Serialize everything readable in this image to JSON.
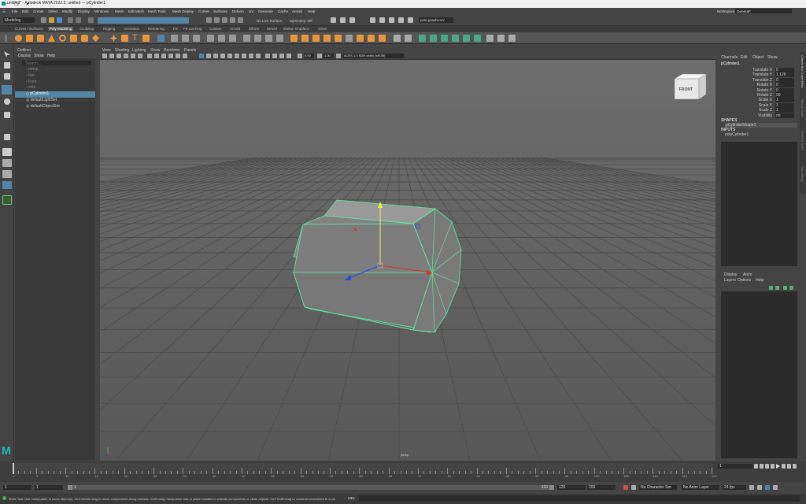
{
  "titlebar": {
    "title": "untitled* - Autodesk MAYA 2022.3: untitled   ---   pCylinder1",
    "minimize": "─",
    "maximize": "❐",
    "close": "✕"
  },
  "menubar": {
    "items": [
      "File",
      "Edit",
      "Create",
      "Select",
      "Modify",
      "Display",
      "Windows",
      "Mesh",
      "Edit Mesh",
      "Mesh Tools",
      "Mesh Display",
      "Curves",
      "Surfaces",
      "Deform",
      "UV",
      "Generate",
      "Cache",
      "Arnold",
      "Help"
    ],
    "workspace_label": "Workspace :",
    "workspace_value": "General*"
  },
  "statusline": {
    "mode": "Modeling",
    "live_surface": "No Live Surface",
    "symmetry": "Symmetry: Off",
    "login": "pete.graphicsrv"
  },
  "shelf_tabs": [
    "Curves / Surfaces",
    "Poly Modeling",
    "Sculpting",
    "Rigging",
    "Animation",
    "Rendering",
    "FX",
    "FX Caching",
    "Custom",
    "Arnold",
    "Bifrost",
    "MASH",
    "Motion Graphics",
    "XGen"
  ],
  "outliner": {
    "title": "Outliner",
    "menus": [
      "Display",
      "Show",
      "Help"
    ],
    "search_placeholder": "Search...",
    "items": [
      "persp",
      "top",
      "front",
      "side",
      "pCylinder1",
      "defaultLightSet",
      "defaultObjectSet"
    ],
    "selected_index": 4
  },
  "viewport": {
    "menus": [
      "View",
      "Shading",
      "Lighting",
      "Show",
      "Renderer",
      "Panels"
    ],
    "exposure": "0.00",
    "gamma": "1.00",
    "colorspace": "ACES 1.0 SDR-video (sRGB)",
    "camera_label": "persp",
    "viewcube_label": "FRONT"
  },
  "channelbox": {
    "menus": [
      "Channels",
      "Edit",
      "Object",
      "Show"
    ],
    "object": "pCylinder1",
    "attrs": [
      {
        "name": "Translate X",
        "value": "0"
      },
      {
        "name": "Translate Y",
        "value": "1.128"
      },
      {
        "name": "Translate Z",
        "value": "0"
      },
      {
        "name": "Rotate X",
        "value": "0"
      },
      {
        "name": "Rotate Y",
        "value": "0"
      },
      {
        "name": "Rotate Z",
        "value": "90"
      },
      {
        "name": "Scale X",
        "value": "1"
      },
      {
        "name": "Scale Y",
        "value": "1"
      },
      {
        "name": "Scale Z",
        "value": "1"
      },
      {
        "name": "Visibility",
        "value": "on"
      }
    ],
    "shapes_label": "SHAPES",
    "shape_name": "pCylinderShape1",
    "inputs_label": "INPUTS",
    "input_name": "polyCylinder1",
    "layer_tabs": [
      "Display",
      "Anim"
    ],
    "layer_menus": [
      "Layers",
      "Options",
      "Help"
    ],
    "side_tabs": [
      "Channel Box / Layer Editor",
      "Attribute Editor",
      "Modeling Toolkit",
      "Tool Settings"
    ]
  },
  "timeline": {
    "ticks": [
      "1",
      "5",
      "10",
      "15",
      "20",
      "25",
      "30",
      "35",
      "40",
      "45",
      "50",
      "55",
      "60",
      "65",
      "70",
      "75",
      "80",
      "85",
      "90",
      "95",
      "100",
      "105",
      "110",
      "115",
      "120"
    ],
    "current_frame": "1",
    "range_start": "1",
    "range_inner_start": "1",
    "range_inner_end": "120",
    "range_end": "120",
    "range_max": "200",
    "character_set": "No Character Set",
    "anim_layer": "No Anim Layer",
    "fps": "24 fps"
  },
  "cmdline": {
    "lang": "MEL",
    "help": "Move Tool: Use manipulator to move object(s). Ctrl+middle-drag to move components along normals. Shift+drag manipulator axis or plane handles to extrude components or clone objects. Ctrl+Shift+drag to constrain movement to a cor"
  },
  "colors": {
    "accent": "#5285a6",
    "selection": "#5eeaa0",
    "shelf_orange": "#e8963c"
  }
}
